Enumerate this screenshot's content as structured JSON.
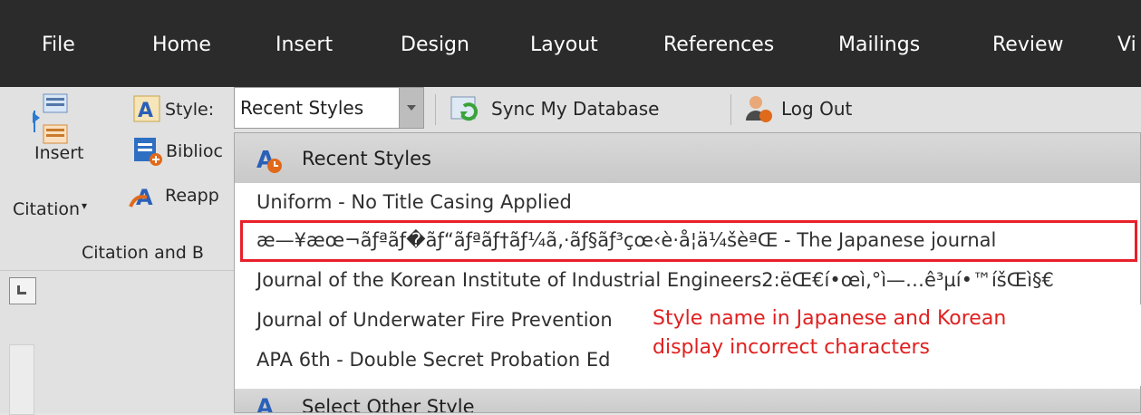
{
  "menubar": {
    "items": [
      "File",
      "Home",
      "Insert",
      "Design",
      "Layout",
      "References",
      "Mailings",
      "Review",
      "Vi"
    ]
  },
  "ribbon": {
    "style_label": "Style:",
    "style_value": "Recent Styles",
    "sync_label": "Sync My Database",
    "logout_label": "Log Out",
    "biblio_label": "Biblioc",
    "reapply_label": "Reapp",
    "insert_citation_line1": "Insert",
    "insert_citation_line2": "Citation",
    "group_label": "Citation and B"
  },
  "dropdown": {
    "header": "Recent Styles",
    "items": [
      "Uniform - No Title Casing Applied",
      "æ—¥æœ¬ãƒªãƒ�ãƒ“ãƒªãƒ†ãƒ¼ã‚·ãƒ§ãƒ³çœ‹è­·å­¦ä¼šèªŒ - The Japanese journal",
      "Journal of the Korean Institute of Industrial Engineers2:ëŒ€í•œì‚°ì—…ê³µí•™íšŒì§€",
      "Journal of Underwater Fire Prevention",
      "APA 6th - Double Secret Probation Ed"
    ],
    "footer": "Select Other Style"
  },
  "annotation": {
    "line1": "Style name in Japanese and Korean",
    "line2": "display incorrect characters"
  },
  "colors": {
    "menubar_bg": "#2b2b2b",
    "highlight": "#e8202a",
    "annotation_text": "#e02020"
  }
}
